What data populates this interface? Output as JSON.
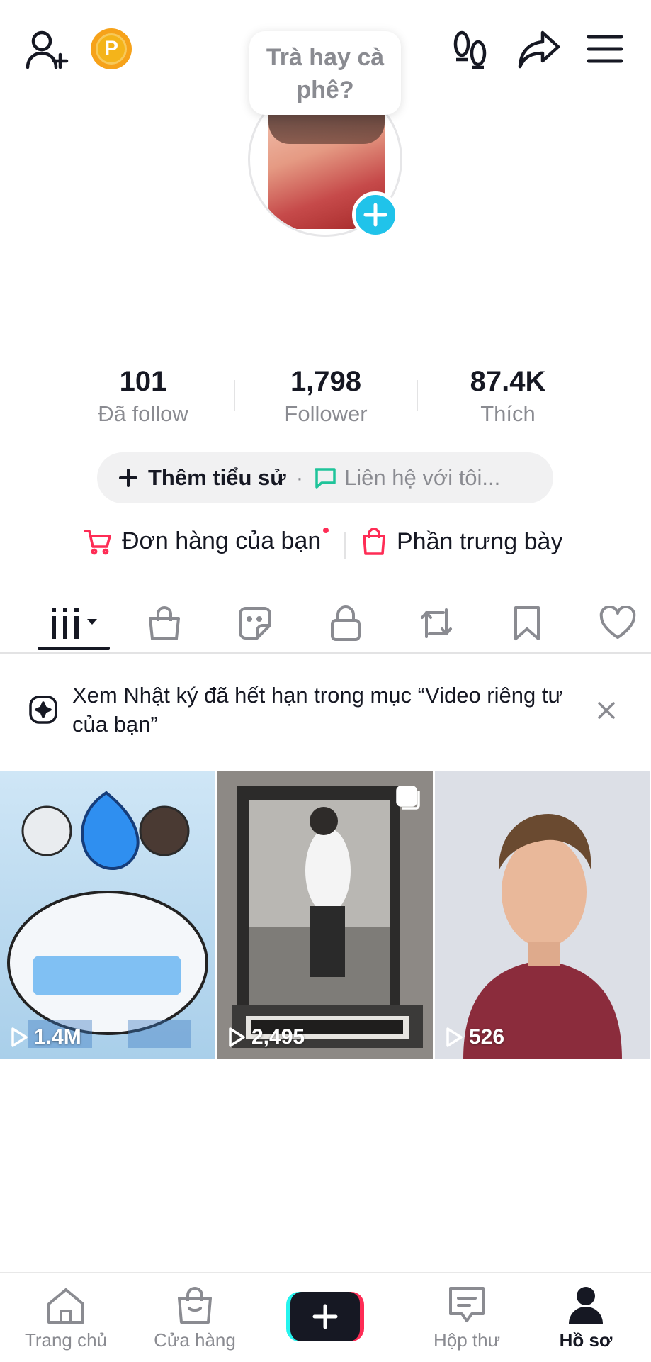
{
  "header": {
    "icons": [
      "add-friend-icon",
      "coin-icon",
      "footprint-icon",
      "share-icon",
      "menu-icon"
    ],
    "coin_letter": "P",
    "status_bubble": "Trà hay cà phê?"
  },
  "stats": [
    {
      "value": "101",
      "label": "Đã follow"
    },
    {
      "value": "1,798",
      "label": "Follower"
    },
    {
      "value": "87.4K",
      "label": "Thích"
    }
  ],
  "bio": {
    "add_bio_label": "Thêm tiểu sử",
    "separator": "·",
    "contact_placeholder": "Liên hệ với tôi..."
  },
  "shop": {
    "orders_label": "Đơn hàng của bạn",
    "showcase_label": "Phần trưng bày"
  },
  "tabs": [
    "videos-grid-icon",
    "shop-bag-icon",
    "sticker-icon",
    "lock-icon",
    "repost-icon",
    "bookmark-icon",
    "heart-icon"
  ],
  "notice": {
    "text": "Xem Nhật ký đã hết hạn trong mục “Video riêng tư của bạn”"
  },
  "videos": [
    {
      "views": "1.4M"
    },
    {
      "views": "2,495"
    },
    {
      "views": "526"
    }
  ],
  "bottom_nav": [
    {
      "label": "Trang chủ",
      "icon": "home-icon"
    },
    {
      "label": "Cửa hàng",
      "icon": "shop-icon"
    },
    {
      "label": "",
      "icon": "create-plus-icon"
    },
    {
      "label": "Hộp thư",
      "icon": "inbox-icon"
    },
    {
      "label": "Hồ sơ",
      "icon": "profile-icon",
      "active": true
    }
  ],
  "colors": {
    "accent_pink": "#fe2c55",
    "accent_cyan": "#25f4ee",
    "avatar_plus": "#20c3ea",
    "text_primary": "#161823",
    "text_secondary": "#8a8b91"
  }
}
